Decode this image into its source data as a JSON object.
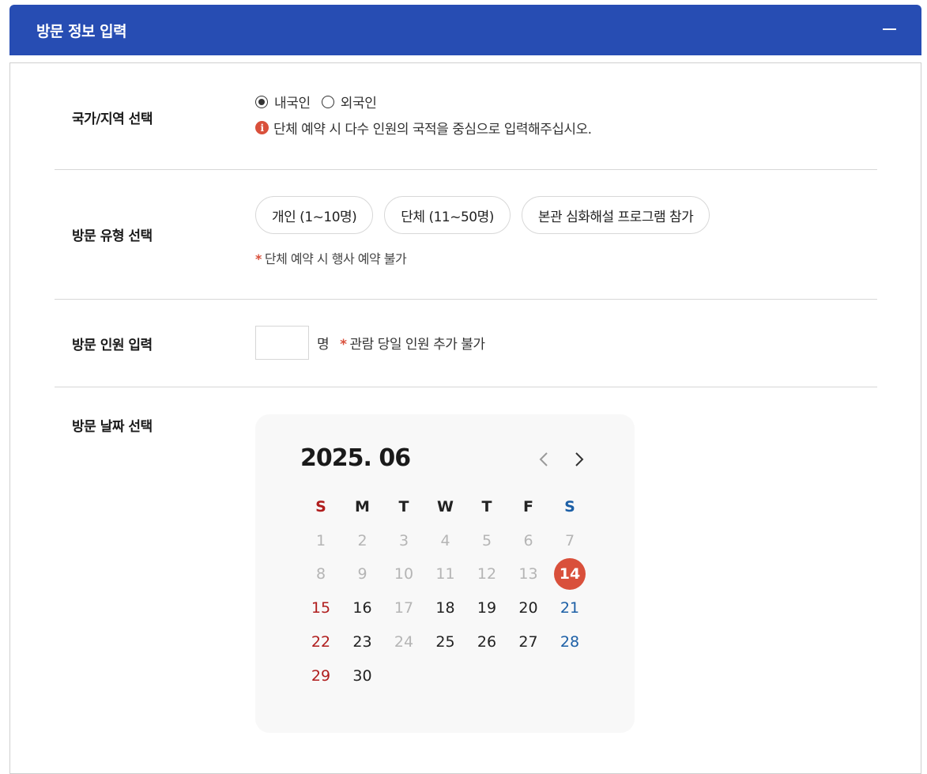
{
  "header": {
    "title": "방문 정보 입력",
    "collapse_icon": "minus-icon"
  },
  "colors": {
    "header_bg": "#274db3",
    "accent_red": "#d9503b",
    "sunday": "#b01d1d",
    "saturday": "#1c5fa6",
    "disabled": "#b5b5b5"
  },
  "nationality": {
    "label": "국가/지역 선택",
    "options": [
      {
        "label": "내국인",
        "checked": true
      },
      {
        "label": "외국인",
        "checked": false
      }
    ],
    "notice_icon": "info-icon",
    "notice": "단체 예약 시 다수 인원의 국적을 중심으로 입력해주십시오."
  },
  "visit_type": {
    "label": "방문 유형 선택",
    "buttons": [
      "개인 (1~10명)",
      "단체 (11~50명)",
      "본관 심화해설 프로그램 참가"
    ],
    "note_star": "*",
    "note": "단체 예약 시 행사 예약 불가"
  },
  "visitor_count": {
    "label": "방문 인원 입력",
    "value": "",
    "unit": "명",
    "note_star": "*",
    "note": "관람 당일 인원 추가 불가"
  },
  "visit_date": {
    "label": "방문 날짜 선택",
    "calendar": {
      "title": "2025. 06",
      "prev_icon": "chevron-left-icon",
      "next_icon": "chevron-right-icon",
      "weekdays": [
        "S",
        "M",
        "T",
        "W",
        "T",
        "F",
        "S"
      ],
      "weeks": [
        [
          "1",
          "2",
          "3",
          "4",
          "5",
          "6",
          "7"
        ],
        [
          "8",
          "9",
          "10",
          "11",
          "12",
          "13",
          "14"
        ],
        [
          "15",
          "16",
          "17",
          "18",
          "19",
          "20",
          "21"
        ],
        [
          "22",
          "23",
          "24",
          "25",
          "26",
          "27",
          "28"
        ],
        [
          "29",
          "30",
          "",
          "",
          "",
          "",
          ""
        ]
      ],
      "disabled_days": [
        1,
        2,
        3,
        4,
        5,
        6,
        7,
        8,
        9,
        10,
        11,
        12,
        13,
        17,
        24
      ],
      "selected_day": 14
    }
  }
}
